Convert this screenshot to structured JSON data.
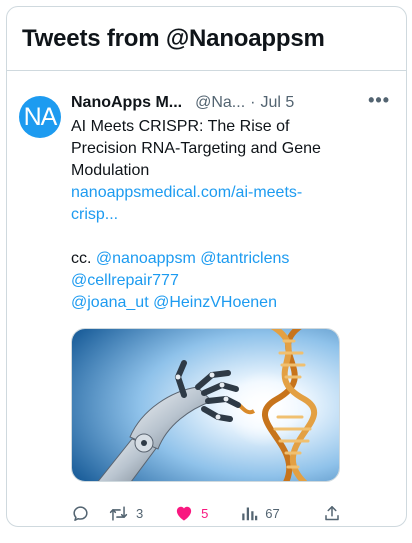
{
  "widget": {
    "title": "Tweets from @Nanoappsm"
  },
  "tweet": {
    "avatar_text": "NA",
    "author_name": "NanoApps M...",
    "author_handle": "@Na...",
    "separator": "·",
    "date": "Jul 5",
    "more": "•••",
    "text_lines": [
      "AI Meets CRISPR: The Rise of",
      "Precision RNA-Targeting and Gene",
      "Modulation"
    ],
    "link_lines": [
      "nanoappsmedical.com/ai-meets-",
      "crisp..."
    ],
    "cc_prefix": "cc.",
    "mentions": [
      "@nanoappsm",
      "@tantriclens",
      "@cellrepair777",
      "@joana_ut",
      "@HeinzVHoenen"
    ],
    "media_alt": "robot hand and DNA helix",
    "reply_icon": "reply-icon",
    "retweet_icon": "retweet-icon",
    "retweet_count": "3",
    "like_icon": "heart-icon",
    "like_count": "5",
    "views_icon": "views-icon",
    "views_count": "67",
    "share_icon": "share-icon"
  },
  "colors": {
    "accent": "#1d9bf0",
    "like": "#f91880",
    "text": "#0f1419",
    "muted": "#536471",
    "border": "#cfd9de"
  }
}
